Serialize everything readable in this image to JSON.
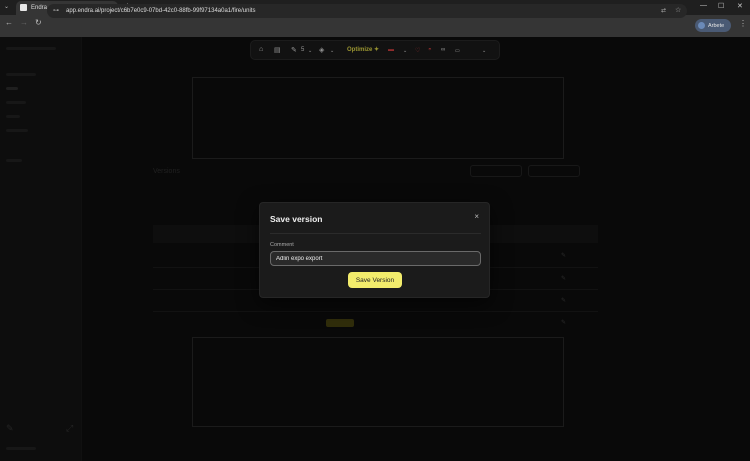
{
  "browser": {
    "tab_title": "Endra",
    "tab_close": "×",
    "new_tab": "+",
    "url": "app.endra.ai/project/c6b7e0c9-07bd-42c0-88fb-99f97134a0a1/fire/units",
    "profile_name": "Arbete",
    "icons": [
      "back-icon",
      "forward-icon",
      "reload-icon",
      "site-info-icon",
      "translate-icon",
      "bookmark-star-icon",
      "minimize-icon",
      "maximize-icon",
      "close-icon"
    ]
  },
  "toolbar": {
    "layer_count": "5",
    "optimize_label": "Optimize",
    "icons": [
      "home-icon",
      "panel-icon",
      "pen-icon",
      "layers-icon",
      "sparkle-icon",
      "red-line-icon",
      "red-cup-icon",
      "red-shape-icon",
      "glasses-icon",
      "ruler-icon",
      "chevron-down-icon"
    ]
  },
  "background_table": {
    "title": "Versions"
  },
  "modal": {
    "title": "Save version",
    "close_glyph": "×",
    "comment_label": "Comment",
    "comment_value": "Adlin expo export",
    "save_label": "Save Version"
  },
  "colors": {
    "accent": "#f2ec6c",
    "optimize": "#e8e04a",
    "background": "#0e0e0e",
    "modal": "#1b1b1b"
  }
}
